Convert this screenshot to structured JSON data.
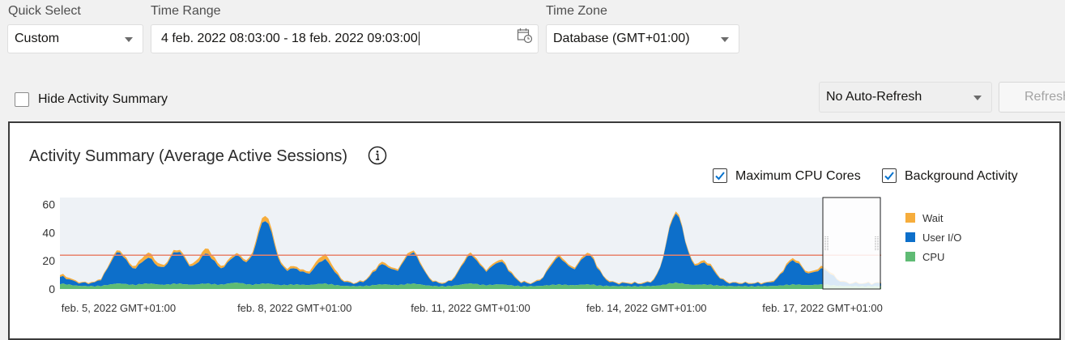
{
  "filters": {
    "quick_select": {
      "label": "Quick Select",
      "value": "Custom"
    },
    "time_range": {
      "label": "Time Range",
      "value": "4 feb. 2022 08:03:00 - 18 feb. 2022 09:03:00"
    },
    "time_zone": {
      "label": "Time Zone",
      "value": "Database (GMT+01:00)"
    }
  },
  "controls": {
    "hide_summary_label": "Hide Activity Summary",
    "auto_refresh": "No Auto-Refresh",
    "refresh_label": "Refresh"
  },
  "panel": {
    "title": "Activity Summary (Average Active Sessions)",
    "options": [
      {
        "label": "Maximum CPU Cores",
        "checked": true
      },
      {
        "label": "Background Activity",
        "checked": true
      }
    ]
  },
  "chart_data": {
    "type": "area",
    "stacked": true,
    "title": "Activity Summary (Average Active Sessions)",
    "y_ticks": [
      "0",
      "20",
      "40",
      "60"
    ],
    "ylim": [
      0,
      65
    ],
    "x_tick_labels": [
      "feb. 5, 2022 GMT+01:00",
      "feb. 8, 2022 GMT+01:00",
      "feb. 11, 2022 GMT+01:00",
      "feb. 14, 2022 GMT+01:00",
      "feb. 17, 2022 GMT+01:00"
    ],
    "x_start": "2022-02-04",
    "x_end": "2022-02-18",
    "max_cpu_cores": 24,
    "series": [
      {
        "name": "Wait",
        "color": "#f6ad3c"
      },
      {
        "name": "User I/O",
        "color": "#0d6fca"
      },
      {
        "name": "CPU",
        "color": "#5fbb74"
      }
    ],
    "cpu_line_color": "#e8826a",
    "peaks": [
      {
        "x": "2022-02-04",
        "cpu": 3,
        "io": 3,
        "wait": 1
      },
      {
        "x": "2022-02-05",
        "cpu": 3,
        "io": 16,
        "wait": 3
      },
      {
        "x": "2022-02-05",
        "cpu": 3,
        "io": 20,
        "wait": 1
      },
      {
        "x": "2022-02-06",
        "cpu": 3,
        "io": 19,
        "wait": 3
      },
      {
        "x": "2022-02-06",
        "cpu": 3,
        "io": 21,
        "wait": 1
      },
      {
        "x": "2022-02-07",
        "cpu": 3,
        "io": 43,
        "wait": 3
      },
      {
        "x": "2022-02-07",
        "cpu": 4,
        "io": 17,
        "wait": 1
      },
      {
        "x": "2022-02-08",
        "cpu": 3,
        "io": 15,
        "wait": 3
      },
      {
        "x": "2022-02-08",
        "cpu": 2,
        "io": 9,
        "wait": 1
      },
      {
        "x": "2022-02-09",
        "cpu": 2,
        "io": 12,
        "wait": 1
      },
      {
        "x": "2022-02-10",
        "cpu": 3,
        "io": 20,
        "wait": 1
      },
      {
        "x": "2022-02-11",
        "cpu": 2,
        "io": 14,
        "wait": 1
      },
      {
        "x": "2022-02-11",
        "cpu": 3,
        "io": 18,
        "wait": 1
      },
      {
        "x": "2022-02-12",
        "cpu": 2,
        "io": 17,
        "wait": 1
      },
      {
        "x": "2022-02-13",
        "cpu": 2,
        "io": 19,
        "wait": 1
      },
      {
        "x": "2022-02-14",
        "cpu": 4,
        "io": 47,
        "wait": 1
      },
      {
        "x": "2022-02-15",
        "cpu": 2,
        "io": 13,
        "wait": 1
      },
      {
        "x": "2022-02-16",
        "cpu": 2,
        "io": 15,
        "wait": 1
      },
      {
        "x": "2022-02-17",
        "cpu": 2,
        "io": 9,
        "wait": 1
      }
    ],
    "legend_position": "right",
    "grid": false
  }
}
